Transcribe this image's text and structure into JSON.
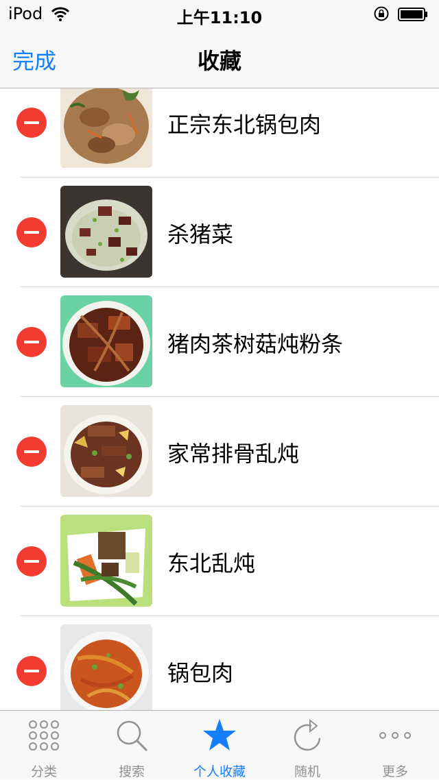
{
  "status_bar": {
    "device": "iPod",
    "time": "上午11:10"
  },
  "nav": {
    "done_label": "完成",
    "title": "收藏"
  },
  "list": {
    "items": [
      {
        "label": "正宗东北锅包肉"
      },
      {
        "label": "杀猪菜"
      },
      {
        "label": "猪肉茶树菇炖粉条"
      },
      {
        "label": "家常排骨乱炖"
      },
      {
        "label": "东北乱炖"
      },
      {
        "label": "锅包肉"
      }
    ]
  },
  "tabs": [
    {
      "label": "分类",
      "icon": "grid-icon",
      "active": false
    },
    {
      "label": "搜索",
      "icon": "search-icon",
      "active": false
    },
    {
      "label": "个人收藏",
      "icon": "star-icon",
      "active": true
    },
    {
      "label": "随机",
      "icon": "refresh-icon",
      "active": false
    },
    {
      "label": "更多",
      "icon": "more-icon",
      "active": false
    }
  ],
  "colors": {
    "accent": "#157efb",
    "delete": "#f23b30",
    "inactive_tab": "#929292"
  }
}
